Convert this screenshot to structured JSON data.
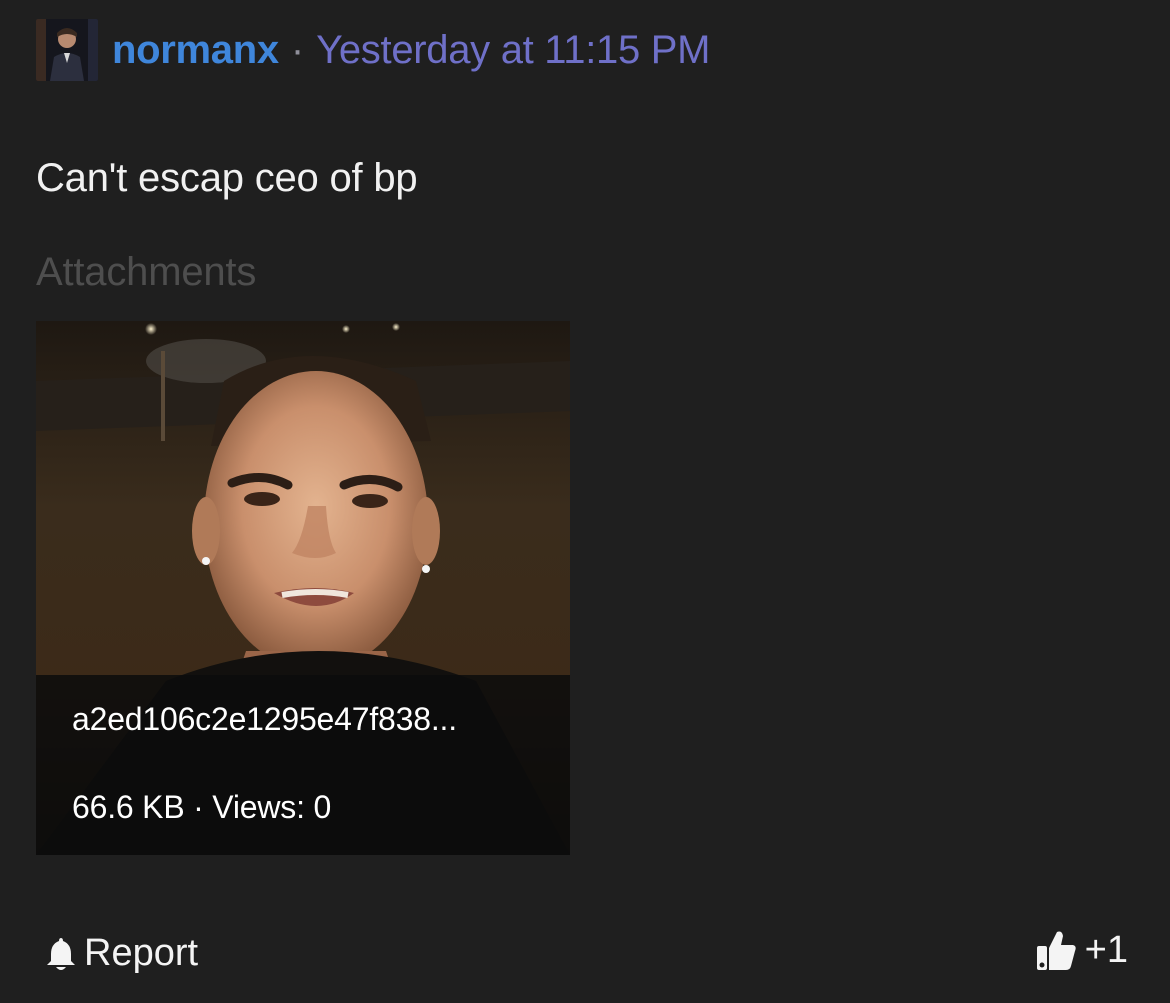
{
  "post": {
    "author": "normanx",
    "separator": "·",
    "timestamp": "Yesterday at 11:15 PM",
    "message": "Can't escap ceo of bp",
    "attachments_label": "Attachments",
    "attachment": {
      "filename": "a2ed106c2e1295e47f838...",
      "meta": "66.6 KB · Views: 0"
    },
    "footer": {
      "report_label": "Report",
      "report_icon": "bell-icon",
      "like_icon": "thumbs-up-icon",
      "like_count": "+1"
    }
  },
  "colors": {
    "background": "#1f1f1f",
    "username": "#3f86db",
    "timestamp": "#6f70c8",
    "muted_label": "#4e4e4e",
    "text": "#f1f1f1"
  }
}
